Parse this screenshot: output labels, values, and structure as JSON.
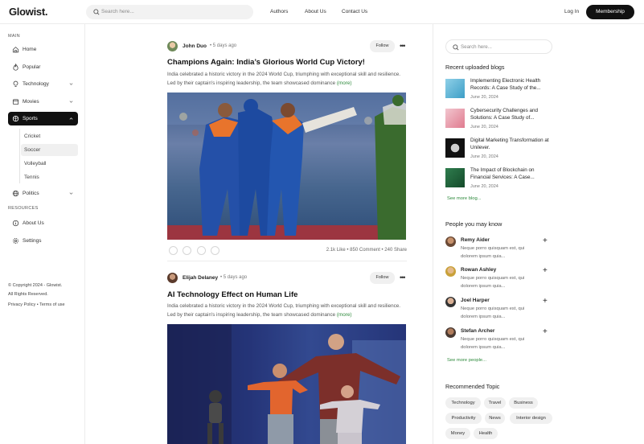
{
  "app": {
    "logo": "Glowist."
  },
  "header": {
    "search_placeholder": "Search here...",
    "nav": [
      "Authors",
      "About Us",
      "Contact Us"
    ],
    "login_label": "Log In",
    "membership_label": "Membership"
  },
  "sidebar": {
    "main_label": "MAIN",
    "items": [
      {
        "label": "Home",
        "icon": "home-icon"
      },
      {
        "label": "Popular",
        "icon": "flame-icon"
      },
      {
        "label": "Technology",
        "icon": "bulb-icon"
      },
      {
        "label": "Movies",
        "icon": "film-icon"
      },
      {
        "label": "Sports",
        "icon": "ball-icon"
      }
    ],
    "sports_sub": [
      "Cricket",
      "Soccer",
      "Volleyball",
      "Tennis"
    ],
    "politics_label": "Politics",
    "resources_label": "RESOURCES",
    "resources": [
      {
        "label": "About Us",
        "icon": "info-icon"
      },
      {
        "label": "Settings",
        "icon": "gear-icon"
      }
    ],
    "footer": {
      "copyright": "© Copyright 2024 - Glowist.",
      "rights": "All Rights Reserved.",
      "policy": "Privacy Policy • Terms of use"
    }
  },
  "feed": {
    "posts": [
      {
        "author": "John Duo",
        "ago": "5 days ago",
        "follow_label": "Follow",
        "title": "Champions Again: India’s Glorious World Cup Victory!",
        "excerpt": "India celebrated a historic victory in the 2024 World Cup, triumphing with exceptional skill and resilience. Led by their captain's inspiring leadership, the team showcased dominance",
        "more_label": "(more)",
        "stats": "2.1k Like • 850 Comment • 240 Share"
      },
      {
        "author": "Elijah Delaney",
        "ago": "5 days ago",
        "follow_label": "Follow",
        "title": "AI Technology Effect on Human Life",
        "excerpt": "India celebrated a historic victory in the 2024 World Cup, triumphing with exceptional skill and resilience. Led by their captain's inspiring leadership, the team showcased dominance",
        "more_label": "(more)"
      }
    ]
  },
  "right": {
    "search_placeholder": "Search here...",
    "recent_title": "Recent uploaded blogs",
    "blogs": [
      {
        "title": "Implementing Electronic Health Records: A Case Study of the...",
        "date": "June 20, 2024"
      },
      {
        "title": "Cybersecurity Challenges and Solutions: A Case Study of...",
        "date": "June 20, 2024"
      },
      {
        "title": "Digital Marketing Transformation at Unilever.",
        "date": "June 20, 2024"
      },
      {
        "title": "The Impact of Blockchain on Financial Services: A Case...",
        "date": "June 20, 2024"
      }
    ],
    "see_more_blog": "See more blog...",
    "people_title": "People you may know",
    "people": [
      {
        "name": "Remy Aider",
        "desc": "Neque porro quisquam est, qui dolorem ipsum quia..."
      },
      {
        "name": "Rowan Ashley",
        "desc": "Neque porro quisquam est, qui dolorem ipsum quia..."
      },
      {
        "name": "Joel Harper",
        "desc": "Neque porro quisquam est, qui dolorem ipsum quia..."
      },
      {
        "name": "Stefan Archer",
        "desc": "Neque porro quisquam est, qui dolorem ipsum quia..."
      }
    ],
    "see_more_people": "See more people...",
    "topics_title": "Recommended Topic",
    "topics": [
      "Technology",
      "Travel",
      "Business",
      "Productivity",
      "News",
      "Interior design",
      "Money",
      "Health"
    ]
  },
  "colors": {
    "accent": "#2e8a3c",
    "active": "#111111"
  }
}
